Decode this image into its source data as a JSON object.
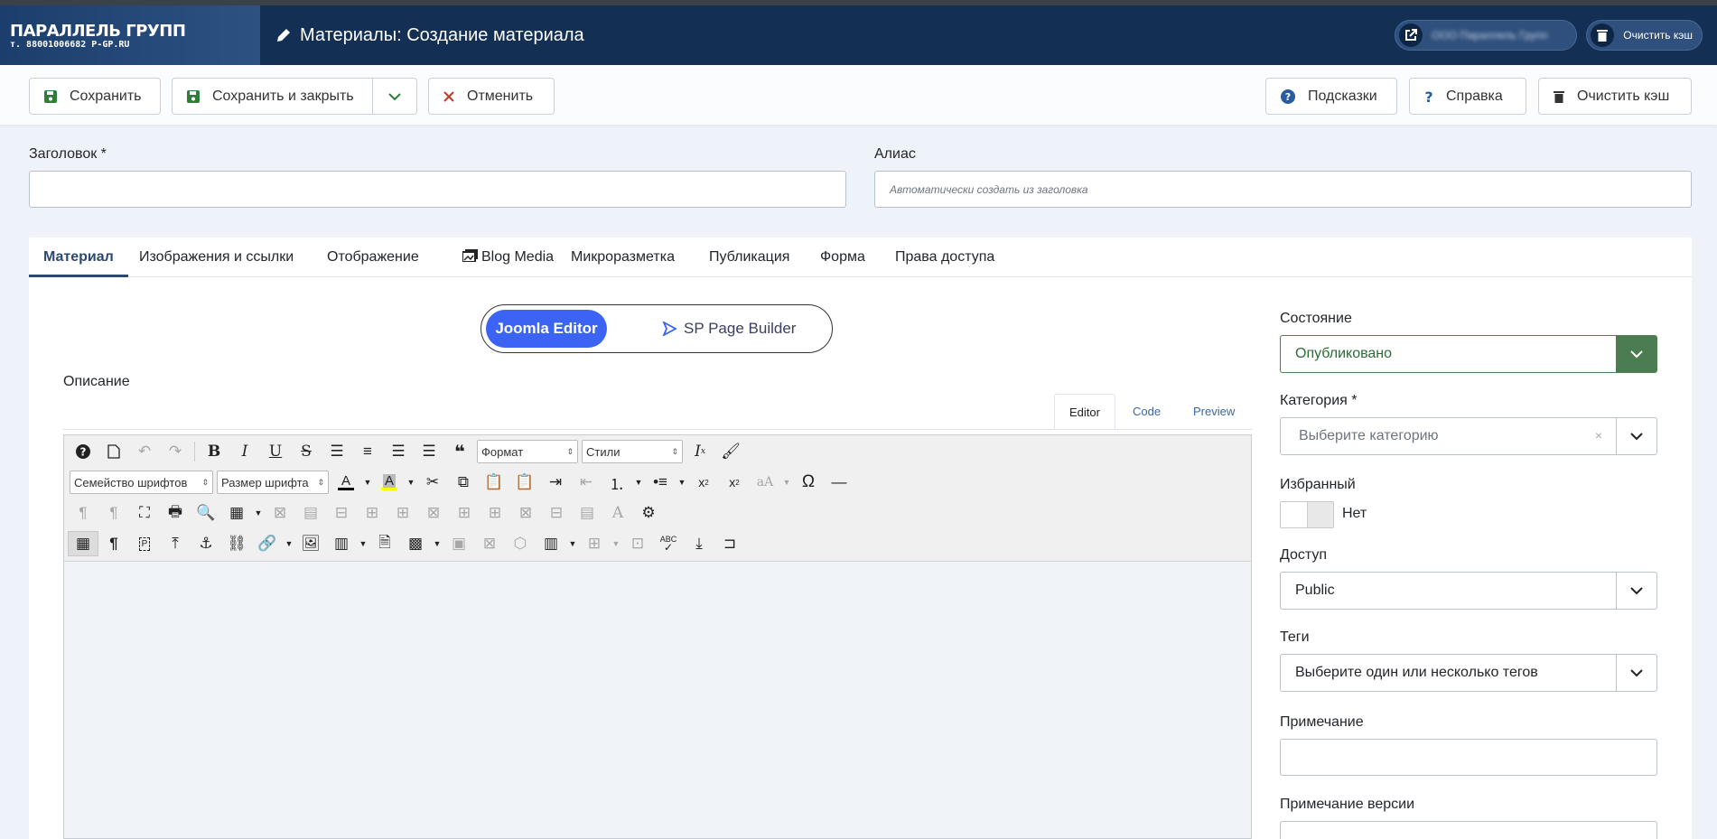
{
  "header": {
    "logo_line1": "ПАРАЛЛЕЛЬ ГРУПП",
    "logo_line2": "т. 88001006682 P-GP.RU",
    "title": "Материалы: Создание материала",
    "site_link_label": "ООО Параллель Групп",
    "clear_cache_label": "Очистить кэш"
  },
  "toolbar": {
    "save": "Сохранить",
    "save_close": "Сохранить и закрыть",
    "cancel": "Отменить",
    "hints": "Подсказки",
    "help": "Справка",
    "clear_cache": "Очистить кэш"
  },
  "form": {
    "title_label": "Заголовок *",
    "title_value": "",
    "alias_label": "Алиас",
    "alias_placeholder": "Автоматически создать из заголовка"
  },
  "tabs": [
    "Материал",
    "Изображения и ссылки",
    "Отображение",
    "Blog Media",
    "Микроразметка",
    "Публикация",
    "Форма",
    "Права доступа"
  ],
  "editor_switch": {
    "joomla": "Joomla Editor",
    "sppb": "SP Page Builder"
  },
  "description_label": "Описание",
  "editor_tabs": [
    "Editor",
    "Code",
    "Preview"
  ],
  "mce": {
    "format_select": "Формат",
    "styles_select": "Стили",
    "font_family_select": "Семейство шрифтов",
    "font_size_select": "Размер шрифта"
  },
  "sidebar": {
    "state_label": "Состояние",
    "state_value": "Опубликовано",
    "category_label": "Категория *",
    "category_placeholder": "Выберите категорию",
    "featured_label": "Избранный",
    "featured_value": "Нет",
    "access_label": "Доступ",
    "access_value": "Public",
    "tags_label": "Теги",
    "tags_placeholder": "Выберите один или несколько тегов",
    "note_label": "Примечание",
    "version_note_label": "Примечание версии"
  },
  "colors": {
    "header": "#132f53",
    "accent": "#3b64f5",
    "state_green": "#4c7d50"
  }
}
